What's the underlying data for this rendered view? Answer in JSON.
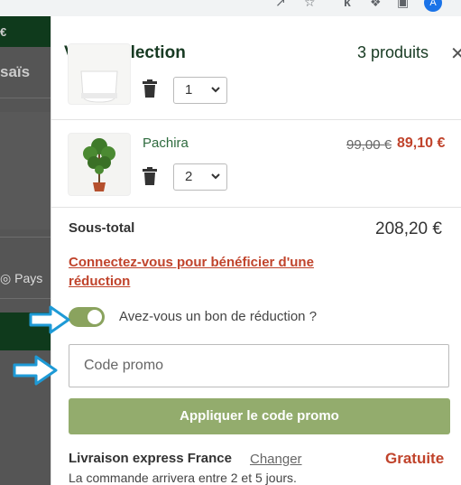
{
  "browser": {
    "icons": [
      "share-icon",
      "star-icon",
      "extension-k-icon",
      "puzzle-icon",
      "sidepanel-icon"
    ],
    "avatar_letter": "A"
  },
  "background_page": {
    "price_fragment": "€",
    "title_fragment": "saïs",
    "country_fragment": "Pays"
  },
  "drawer": {
    "title": "Votre sélection",
    "count": "3 produits",
    "items": [
      {
        "quantity": "1"
      },
      {
        "name": "Pachira",
        "old_price": "99,00 €",
        "price": "89,10 €",
        "quantity": "2"
      }
    ],
    "subtotal_label": "Sous-total",
    "subtotal_value": "208,20 €",
    "login_link": "Connectez-vous pour bénéficier d'une réduction",
    "voucher_label": "Avez-vous un bon de réduction ?",
    "voucher_toggle_on": true,
    "promo_placeholder": "Code promo",
    "apply_button": "Appliquer le code promo",
    "delivery_label": "Livraison express France",
    "change_link": "Changer",
    "delivery_price": "Gratuite",
    "delivery_note": "La commande arrivera entre 2 et 5 jours."
  },
  "colors": {
    "brand_dark_green": "#173a22",
    "accent_red": "#c0432b",
    "button_green": "#93ac6d",
    "annotation_blue": "#1e9ad6"
  }
}
